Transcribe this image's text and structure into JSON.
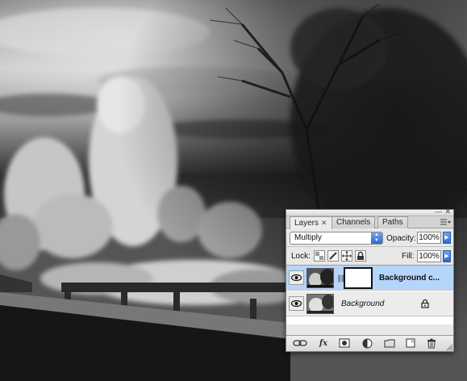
{
  "panel": {
    "tabs": [
      {
        "label": "Layers",
        "active": true
      },
      {
        "label": "Channels",
        "active": false
      },
      {
        "label": "Paths",
        "active": false
      }
    ],
    "tab_close_glyph": "✕",
    "blend_mode": "Multiply",
    "opacity_label": "Opacity:",
    "opacity_value": "100%",
    "lock_label": "Lock:",
    "fill_label": "Fill:",
    "fill_value": "100%",
    "layers": [
      {
        "name": "Background c...",
        "selected": true,
        "visible": true,
        "has_mask": true,
        "locked": false
      },
      {
        "name": "Background",
        "selected": false,
        "visible": true,
        "has_mask": false,
        "locked": true
      }
    ],
    "footer_fx": "fx",
    "accent_color": "#b6d5fb",
    "icons": [
      "eye-icon",
      "chain-icon",
      "lock-icon",
      "link-layers-icon",
      "fx-icon",
      "add-mask-icon",
      "adjustment-layer-icon",
      "new-group-icon",
      "new-layer-icon",
      "trash-icon",
      "palette-menu-icon",
      "move-icon",
      "brush-icon",
      "transparency-lock-icon"
    ]
  }
}
